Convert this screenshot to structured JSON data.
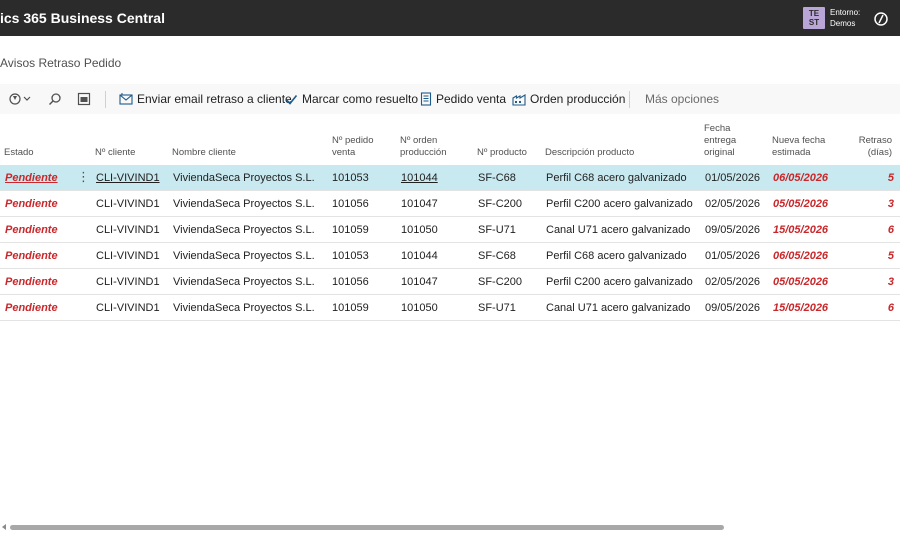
{
  "header": {
    "app_title": "ics 365 Business Central",
    "env_badge_line1": "TE",
    "env_badge_line2": "ST",
    "env_label": "Entorno:",
    "env_value": "Demos"
  },
  "page": {
    "title": "Avisos Retraso Pedido"
  },
  "actions": {
    "enviar_email": "Enviar email retraso a cliente",
    "marcar_resuelto": "Marcar como resuelto",
    "pedido_venta": "Pedido venta",
    "orden_produccion": "Orden producción",
    "mas_opciones": "Más opciones"
  },
  "columns": {
    "estado": "Estado",
    "cliente": "Nº cliente",
    "nombre": "Nombre cliente",
    "pedido_l1": "Nº pedido",
    "pedido_l2": "venta",
    "orden_l1": "Nº orden",
    "orden_l2": "producción",
    "producto": "Nº producto",
    "descripcion": "Descripción producto",
    "fecha_l1": "Fecha",
    "fecha_l2": "entrega",
    "fecha_l3": "original",
    "nueva_l1": "Nueva fecha",
    "nueva_l2": "estimada",
    "retraso_l1": "Retraso",
    "retraso_l2": "(días)"
  },
  "rows": [
    {
      "estado": "Pendiente",
      "cliente": "CLI-VIVIND1",
      "nombre": "ViviendaSeca Proyectos S.L.",
      "pedido": "101053",
      "orden": "101044",
      "producto": "SF-C68",
      "descripcion": "Perfil C68 acero galvanizado",
      "fecha_original": "01/05/2026",
      "nueva_fecha": "06/05/2026",
      "retraso": "5"
    },
    {
      "estado": "Pendiente",
      "cliente": "CLI-VIVIND1",
      "nombre": "ViviendaSeca Proyectos S.L.",
      "pedido": "101056",
      "orden": "101047",
      "producto": "SF-C200",
      "descripcion": "Perfil C200 acero galvanizado",
      "fecha_original": "02/05/2026",
      "nueva_fecha": "05/05/2026",
      "retraso": "3"
    },
    {
      "estado": "Pendiente",
      "cliente": "CLI-VIVIND1",
      "nombre": "ViviendaSeca Proyectos S.L.",
      "pedido": "101059",
      "orden": "101050",
      "producto": "SF-U71",
      "descripcion": "Canal U71 acero galvanizado",
      "fecha_original": "09/05/2026",
      "nueva_fecha": "15/05/2026",
      "retraso": "6"
    },
    {
      "estado": "Pendiente",
      "cliente": "CLI-VIVIND1",
      "nombre": "ViviendaSeca Proyectos S.L.",
      "pedido": "101053",
      "orden": "101044",
      "producto": "SF-C68",
      "descripcion": "Perfil C68 acero galvanizado",
      "fecha_original": "01/05/2026",
      "nueva_fecha": "06/05/2026",
      "retraso": "5"
    },
    {
      "estado": "Pendiente",
      "cliente": "CLI-VIVIND1",
      "nombre": "ViviendaSeca Proyectos S.L.",
      "pedido": "101056",
      "orden": "101047",
      "producto": "SF-C200",
      "descripcion": "Perfil C200 acero galvanizado",
      "fecha_original": "02/05/2026",
      "nueva_fecha": "05/05/2026",
      "retraso": "3"
    },
    {
      "estado": "Pendiente",
      "cliente": "CLI-VIVIND1",
      "nombre": "ViviendaSeca Proyectos S.L.",
      "pedido": "101059",
      "orden": "101050",
      "producto": "SF-U71",
      "descripcion": "Canal U71 acero galvanizado",
      "fecha_original": "09/05/2026",
      "nueva_fecha": "15/05/2026",
      "retraso": "6"
    }
  ],
  "colors": {
    "topbar": "#2b2b2b",
    "selected_row": "#c8e9ef",
    "alert_red": "#c8282b",
    "action_icon_blue": "#1e5a8a"
  },
  "icons": {
    "filter": "filter-toggle-icon",
    "search": "search-icon",
    "layout": "layout-icon",
    "email": "email-icon",
    "check": "checkmark-icon",
    "document": "document-icon",
    "factory": "factory-icon",
    "copilot": "copilot-icon"
  }
}
